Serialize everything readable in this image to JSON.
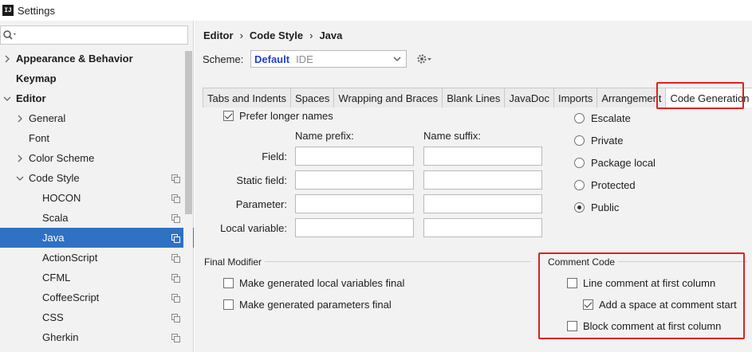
{
  "window": {
    "title": "Settings",
    "app_icon_text": "IJ"
  },
  "sidebar": {
    "search_placeholder": "",
    "items": [
      {
        "label": "Appearance & Behavior"
      },
      {
        "label": "Keymap"
      },
      {
        "label": "Editor"
      },
      {
        "label": "General"
      },
      {
        "label": "Font"
      },
      {
        "label": "Color Scheme"
      },
      {
        "label": "Code Style"
      },
      {
        "label": "HOCON"
      },
      {
        "label": "Scala"
      },
      {
        "label": "Java"
      },
      {
        "label": "ActionScript"
      },
      {
        "label": "CFML"
      },
      {
        "label": "CoffeeScript"
      },
      {
        "label": "CSS"
      },
      {
        "label": "Gherkin"
      }
    ],
    "selected": "Java"
  },
  "breadcrumb": {
    "part1": "Editor",
    "part2": "Code Style",
    "part3": "Java",
    "separator": "›"
  },
  "scheme": {
    "label": "Scheme:",
    "value": "Default",
    "type": "IDE"
  },
  "tabs": [
    {
      "label": "Tabs and Indents"
    },
    {
      "label": "Spaces"
    },
    {
      "label": "Wrapping and Braces"
    },
    {
      "label": "Blank Lines"
    },
    {
      "label": "JavaDoc"
    },
    {
      "label": "Imports"
    },
    {
      "label": "Arrangement"
    },
    {
      "label": "Code Generation"
    }
  ],
  "active_tab": "Code Generation",
  "naming": {
    "prefer_longer_names": {
      "label": "Prefer longer names",
      "checked": true
    },
    "prefix_header": "Name prefix:",
    "suffix_header": "Name suffix:",
    "rows": [
      {
        "label": "Field:",
        "prefix": "",
        "suffix": ""
      },
      {
        "label": "Static field:",
        "prefix": "",
        "suffix": ""
      },
      {
        "label": "Parameter:",
        "prefix": "",
        "suffix": ""
      },
      {
        "label": "Local variable:",
        "prefix": "",
        "suffix": ""
      }
    ]
  },
  "visibility": {
    "options": [
      {
        "label": "Escalate",
        "checked": false
      },
      {
        "label": "Private",
        "checked": false
      },
      {
        "label": "Package local",
        "checked": false
      },
      {
        "label": "Protected",
        "checked": false
      },
      {
        "label": "Public",
        "checked": true
      }
    ]
  },
  "final_modifier": {
    "title": "Final Modifier",
    "options": [
      {
        "label": "Make generated local variables final",
        "checked": false
      },
      {
        "label": "Make generated parameters final",
        "checked": false
      }
    ]
  },
  "comment_code": {
    "title": "Comment Code",
    "options": [
      {
        "label": "Line comment at first column",
        "checked": false
      },
      {
        "label": "Add a space at comment start",
        "checked": true
      },
      {
        "label": "Block comment at first column",
        "checked": false
      }
    ]
  },
  "colors": {
    "selection": "#2f71c2",
    "highlight": "#e02020",
    "scheme_name": "#1f3fd6"
  }
}
